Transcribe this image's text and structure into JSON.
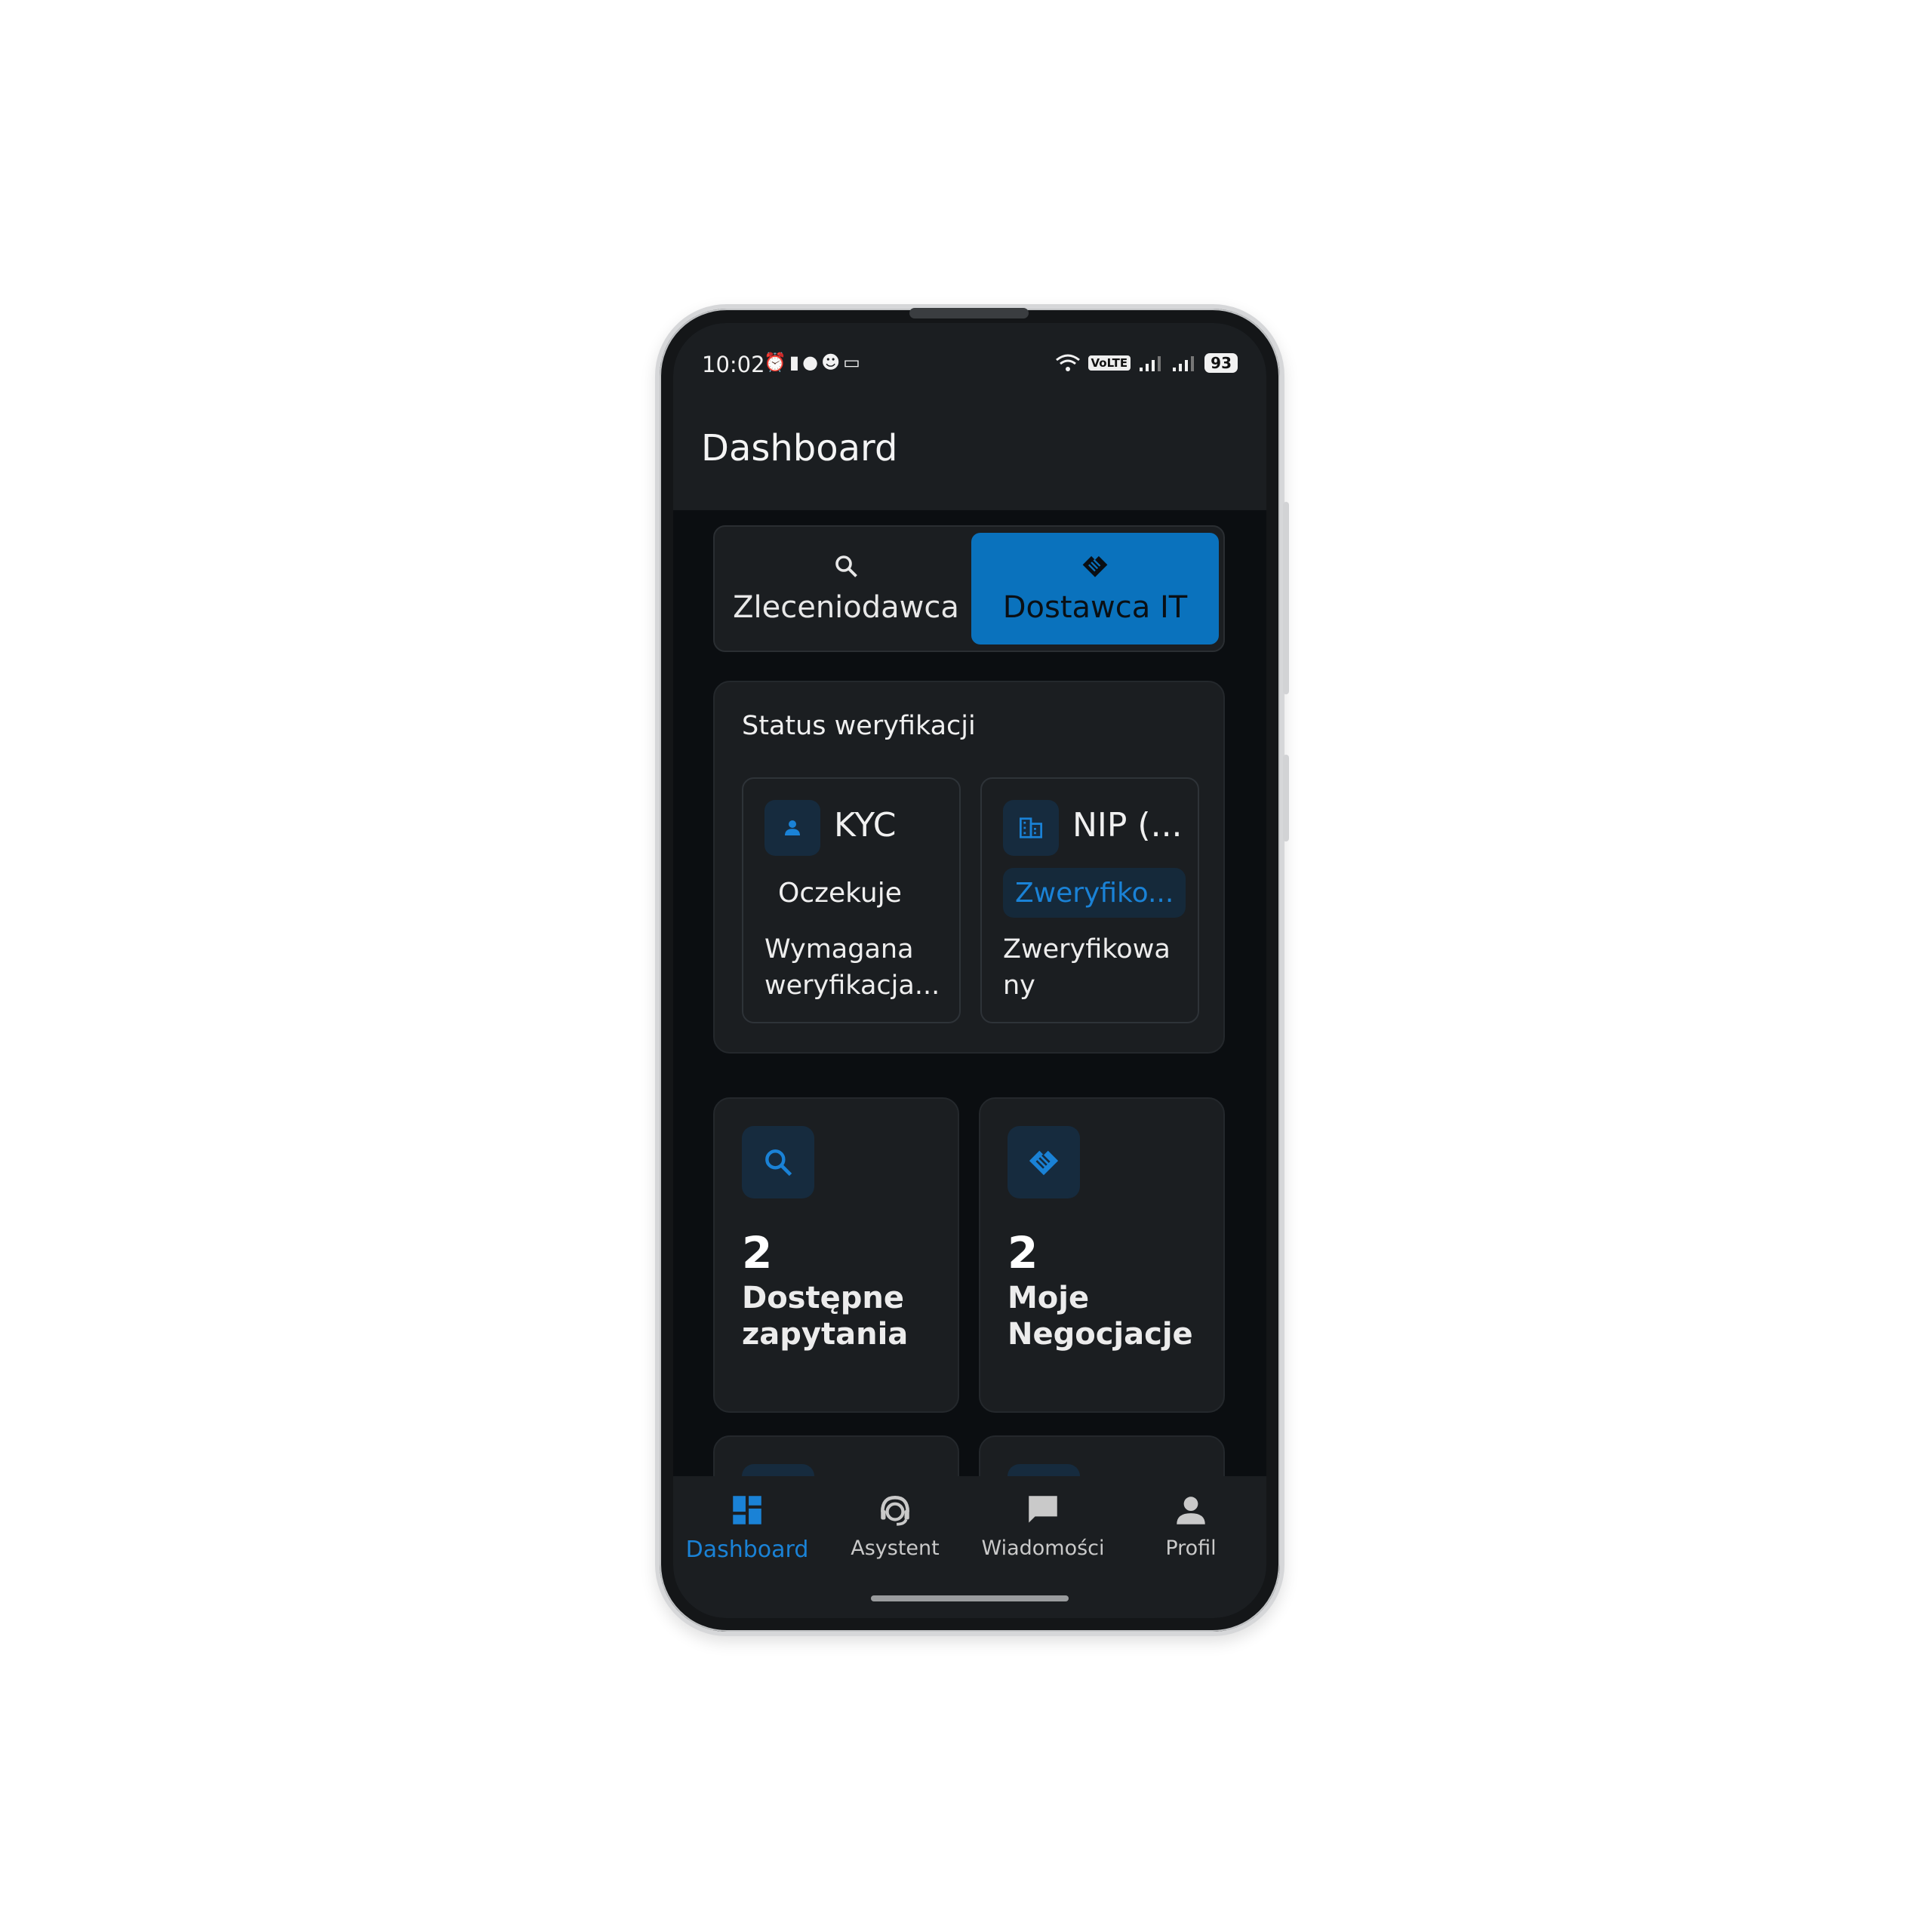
{
  "status_bar": {
    "time": "10:02",
    "icons_left": [
      "alarm-icon",
      "vibrate-icon",
      "chat-bubble-icon",
      "group-icon",
      "message-icon"
    ],
    "volte": "VoLTE",
    "battery": "93"
  },
  "header": {
    "title": "Dashboard"
  },
  "role_switch": {
    "options": [
      {
        "label": "Zleceniodawca",
        "icon": "search-icon",
        "selected": false
      },
      {
        "label": "Dostawca IT",
        "icon": "handshake-icon",
        "selected": true
      }
    ],
    "accent": "#0a72bd"
  },
  "verification": {
    "title": "Status weryfikacji",
    "items": [
      {
        "name": "KYC",
        "icon": "person-icon",
        "status": "Oczekuje",
        "description": "Wymagana weryfikacja..."
      },
      {
        "name": "NIP (...",
        "icon": "business-icon",
        "status": "Zweryfiko...",
        "description": "Zweryfikowa ny"
      }
    ]
  },
  "stats": [
    {
      "value": "2",
      "label": "Dostępne zapytania",
      "icon": "search-icon"
    },
    {
      "value": "2",
      "label": "Moje Negocjacje",
      "icon": "handshake-icon"
    }
  ],
  "bottom_nav": {
    "items": [
      {
        "label": "Dashboard",
        "icon": "dashboard-icon",
        "active": true
      },
      {
        "label": "Asystent",
        "icon": "support-agent-icon",
        "active": false
      },
      {
        "label": "Wiadomości",
        "icon": "chat-icon",
        "active": false
      },
      {
        "label": "Profil",
        "icon": "person-icon",
        "active": false
      }
    ],
    "active_color": "#1a82d6"
  }
}
